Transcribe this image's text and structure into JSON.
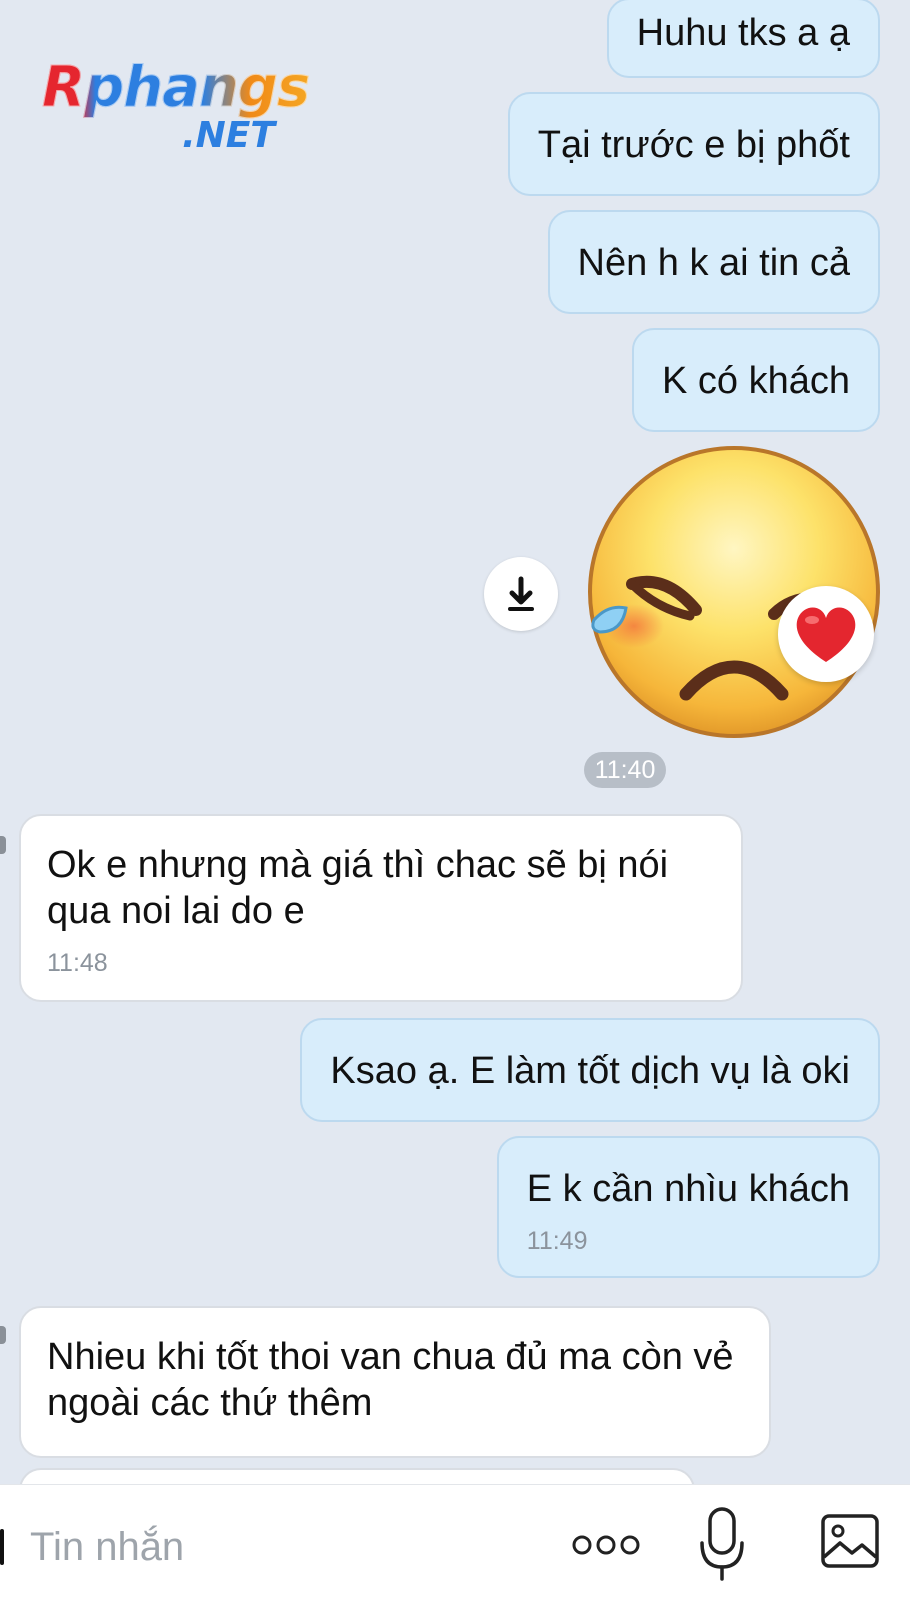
{
  "watermark": {
    "brand": "Rphangs",
    "suffix": ".NET"
  },
  "messages": {
    "m1": "Huhu tks a ạ",
    "m2": "Tại trước e bị phốt",
    "m3": "Nên h k ai tin cả",
    "m4": "K có khách",
    "sticker": {
      "icon": "sad-crying-face-sticker",
      "reaction": "heart"
    },
    "divider_time": "11:40",
    "m5": {
      "text": "Ok e nhưng mà giá thì chac sẽ bị nói qua noi lai do e",
      "time": "11:48"
    },
    "m6": "Ksao ạ. E làm tốt dịch vụ là oki",
    "m7": {
      "text": "E k cần nhìu khách",
      "time": "11:49"
    },
    "m8": "Nhieu khi tốt thoi van chua đủ ma còn vẻ ngoài các thứ thêm"
  },
  "composer": {
    "placeholder": "Tin nhắn",
    "icons": [
      "more-options-icon",
      "microphone-icon",
      "image-icon"
    ]
  },
  "colors": {
    "background": "#e2e8f1",
    "outgoing_bubble": "#d8edfb",
    "incoming_bubble": "#ffffff",
    "heart": "#e4262f"
  }
}
